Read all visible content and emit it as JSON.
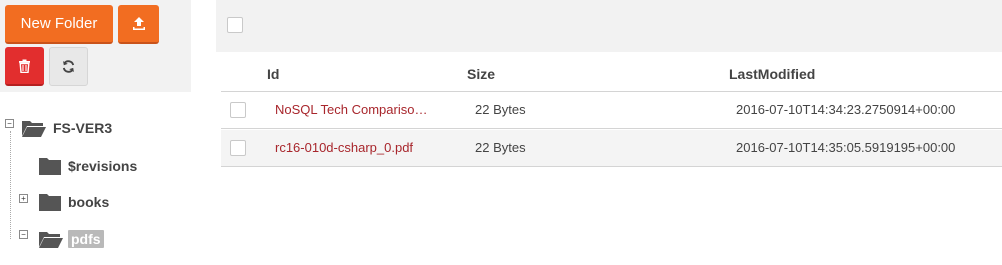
{
  "toolbar": {
    "new_folder_label": "New Folder",
    "upload_icon": "upload-icon",
    "delete_icon": "trash-icon",
    "refresh_icon": "refresh-icon",
    "primary_color": "#f26d21",
    "danger_color": "#e22e2e"
  },
  "tree": {
    "root": {
      "label": "FS-VER3",
      "expanded": true,
      "icon": "folder-open-icon"
    },
    "children": [
      {
        "label": "$revisions",
        "icon": "folder-icon",
        "expander": ""
      },
      {
        "label": "books",
        "icon": "folder-icon",
        "expander": "+"
      },
      {
        "label": "pdfs",
        "icon": "folder-open-icon",
        "expander": "−",
        "selected": true
      }
    ]
  },
  "grid": {
    "columns": [
      "Id",
      "Size",
      "LastModified"
    ],
    "rows": [
      {
        "id": "NoSQL Tech Compariso…",
        "size": "22 Bytes",
        "last_modified": "2016-07-10T14:34:23.2750914+00:00"
      },
      {
        "id": "rc16-010d-csharp_0.pdf",
        "size": "22 Bytes",
        "last_modified": "2016-07-10T14:35:05.5919195+00:00"
      }
    ],
    "link_color": "#a8262c"
  }
}
